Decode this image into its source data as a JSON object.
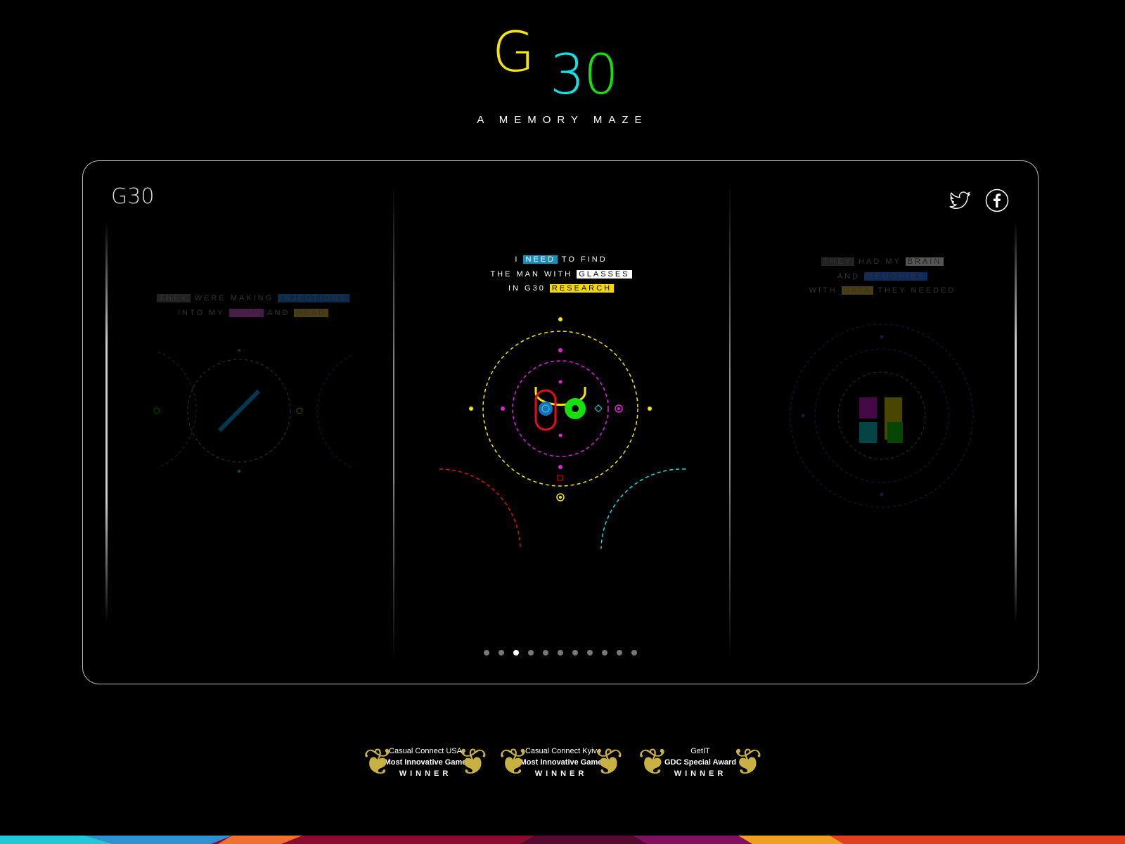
{
  "header": {
    "logo_g": "G",
    "logo_3": "3",
    "logo_0": "0",
    "tagline": "A MEMORY MAZE"
  },
  "colors": {
    "yellow": "#f5e600",
    "cyan": "#11e0e8",
    "green": "#16e00e",
    "magenta": "#e020e0",
    "red": "#e0101a",
    "blue": "#1a8fb8"
  },
  "frame": {
    "logo": "G30",
    "social": [
      "twitter-icon",
      "facebook-icon"
    ]
  },
  "slides": [
    {
      "lines": [
        [
          {
            "t": "THEY",
            "hl": "#222"
          },
          {
            "t": "WERE MAKING"
          },
          {
            "t": "INJECTIONS",
            "hl": "#0c2a4a"
          }
        ],
        [
          {
            "t": "INTO MY"
          },
          {
            "t": "BODY",
            "hl": "#4a1a4a"
          },
          {
            "t": "AND"
          },
          {
            "t": "HEAD",
            "hl": "#4a3e10"
          }
        ]
      ]
    },
    {
      "lines": [
        [
          {
            "t": "I"
          },
          {
            "t": "NEED",
            "hl": "#1a8fb8"
          },
          {
            "t": "TO FIND"
          }
        ],
        [
          {
            "t": "THE MAN WITH"
          },
          {
            "t": "GLASSES",
            "hl": "#ffffff",
            "dark": true
          }
        ],
        [
          {
            "t": "IN G30"
          },
          {
            "t": "RESEARCH",
            "hl": "#f5d800",
            "dark": true
          }
        ]
      ]
    },
    {
      "lines": [
        [
          {
            "t": "THEY",
            "hl": "#222"
          },
          {
            "t": "HAD MY"
          },
          {
            "t": "BRAIN",
            "hl": "#555",
            "dark": true
          }
        ],
        [
          {
            "t": "AND"
          },
          {
            "t": "MEMORIES",
            "hl": "#0c2a5a"
          }
        ],
        [
          {
            "t": "WITH"
          },
          {
            "t": "DATA",
            "hl": "#4a3e10"
          },
          {
            "t": "THEY NEEDED"
          }
        ]
      ]
    }
  ],
  "pagination": {
    "count": 11,
    "active": 3
  },
  "awards": [
    {
      "event": "Casual Connect USA",
      "title": "Most Innovative Game",
      "result": "WINNER"
    },
    {
      "event": "Casual Connect Kyiv",
      "title": "Most Innovative Game",
      "result": "WINNER"
    },
    {
      "event": "GetIT",
      "title": "GDC Special Award",
      "result": "WINNER"
    }
  ]
}
